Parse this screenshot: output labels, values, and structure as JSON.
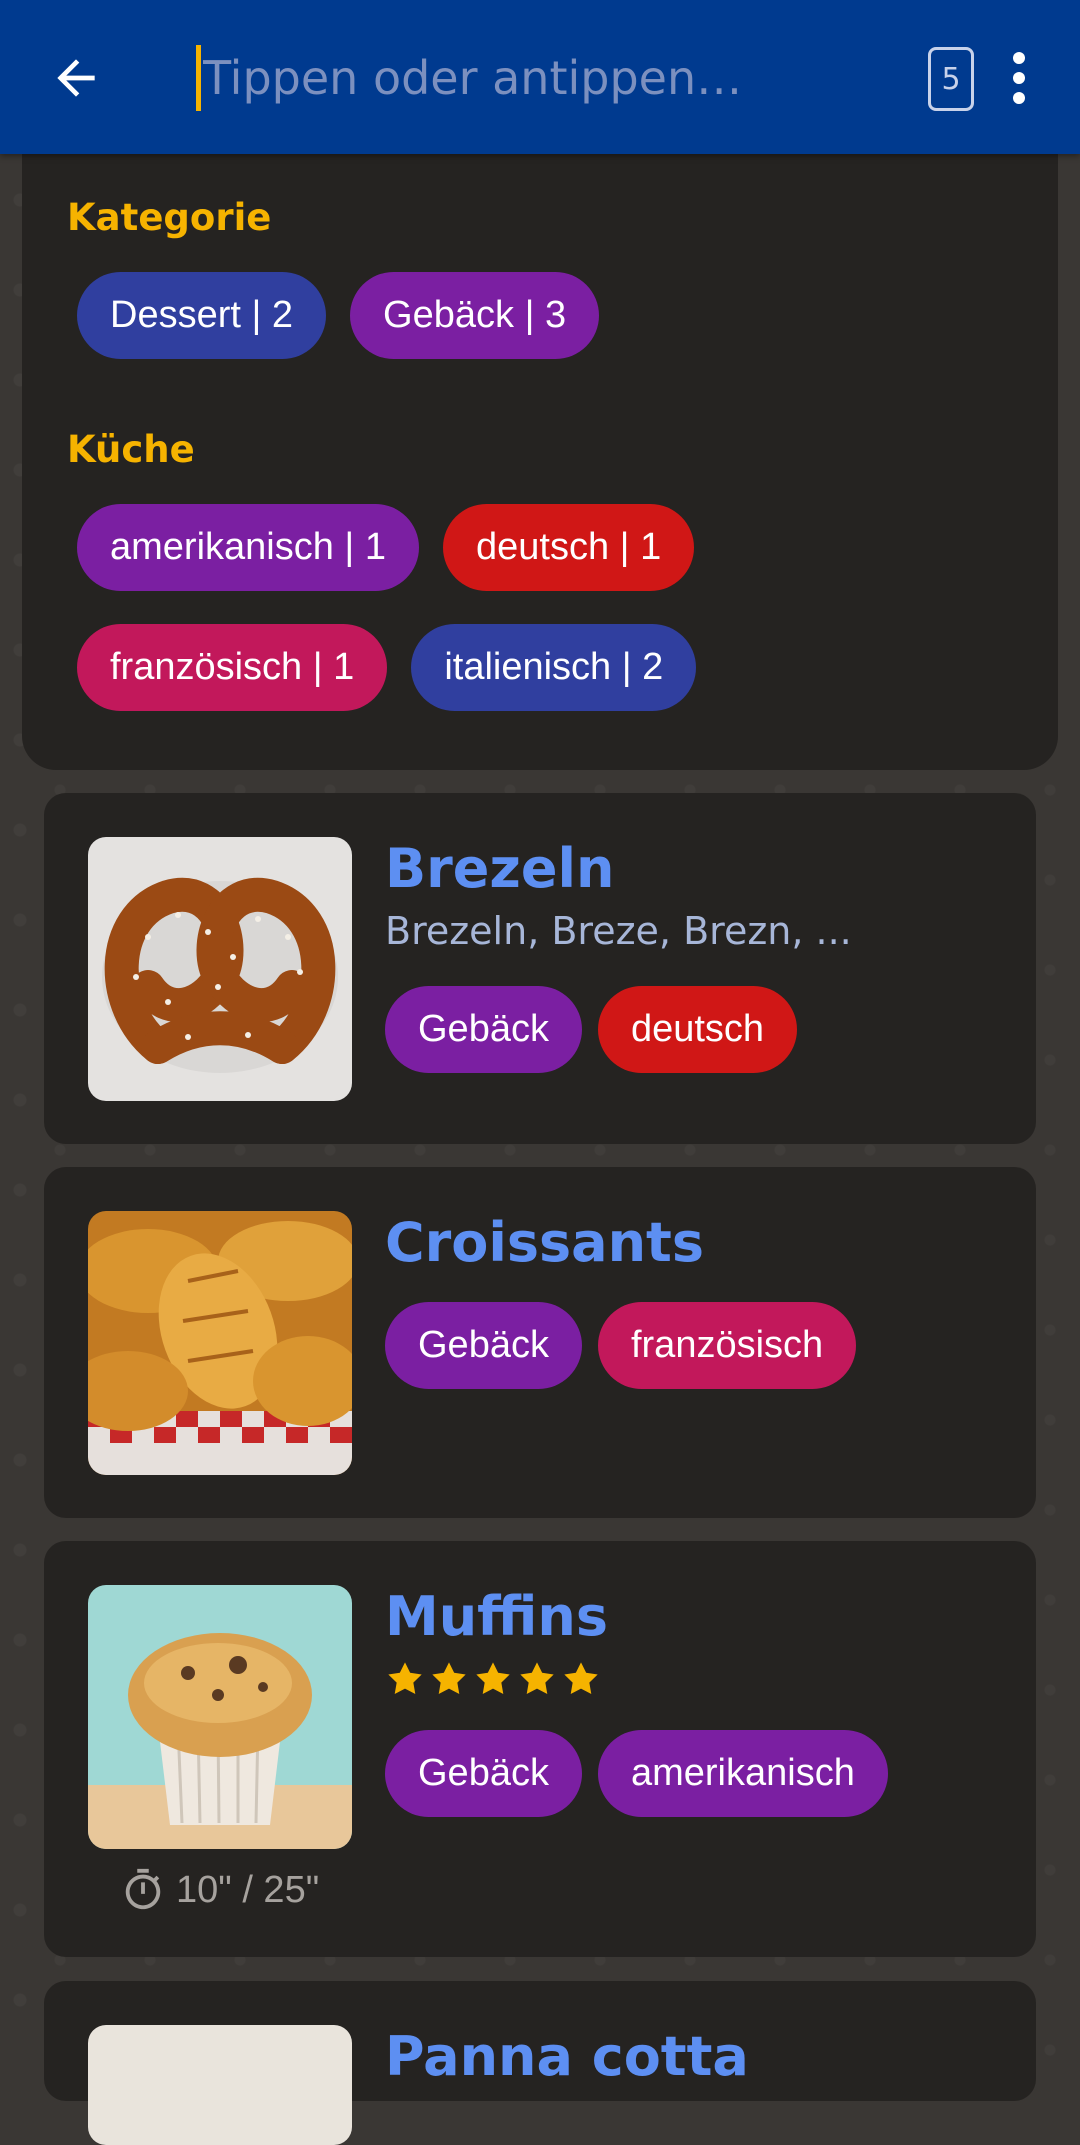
{
  "search": {
    "placeholder": "Tippen oder antippen…",
    "result_count": "5"
  },
  "filters": {
    "category_heading": "Kategorie",
    "categories": [
      {
        "label": "Dessert | 2",
        "color": "#303f9f"
      },
      {
        "label": "Gebäck | 3",
        "color": "#7b1fa2"
      }
    ],
    "cuisine_heading": "Küche",
    "cuisines": [
      {
        "label": "amerikanisch | 1",
        "color": "#7b1fa2"
      },
      {
        "label": "deutsch | 1",
        "color": "#d01716"
      },
      {
        "label": "französisch | 1",
        "color": "#c2185b"
      },
      {
        "label": "italienisch | 2",
        "color": "#303f9f"
      }
    ]
  },
  "recipes": [
    {
      "title": "Brezeln",
      "subtitle": "Brezeln, Breze, Brezn, ...",
      "tags": [
        {
          "label": "Gebäck",
          "color": "#7b1fa2"
        },
        {
          "label": "deutsch",
          "color": "#d01716"
        }
      ]
    },
    {
      "title": "Croissants",
      "tags": [
        {
          "label": "Gebäck",
          "color": "#7b1fa2"
        },
        {
          "label": "französisch",
          "color": "#c2185b"
        }
      ]
    },
    {
      "title": "Muffins",
      "rating": 5,
      "tags": [
        {
          "label": "Gebäck",
          "color": "#7b1fa2"
        },
        {
          "label": "amerikanisch",
          "color": "#7b1fa2"
        }
      ],
      "time": "10\" / 25\""
    },
    {
      "title": "Panna cotta"
    }
  ],
  "colors": {
    "topbar": "#003a8f",
    "accent": "#f6b300",
    "title": "#5d8ff2"
  }
}
